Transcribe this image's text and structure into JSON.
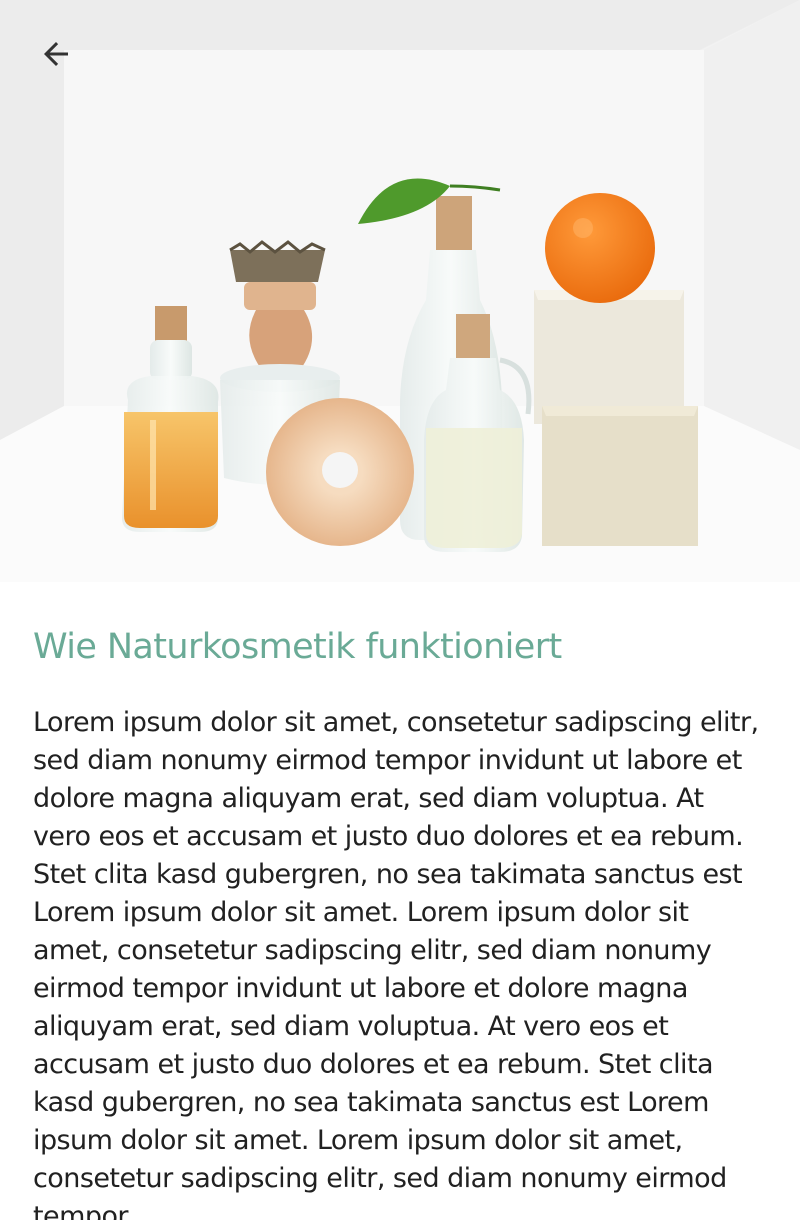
{
  "header": {
    "back_icon": "arrow-left-icon",
    "hero_image": "natural-cosmetics-bottles-soap-brush-orange-photo"
  },
  "article": {
    "title": "Wie Naturkosmetik funktioniert",
    "body": "Lorem ipsum dolor sit amet, consetetur sadipscing elitr, sed diam nonumy eirmod tempor invidunt ut labore et dolore magna aliquyam erat, sed diam voluptua. At vero eos et accusam et justo duo dolores et ea rebum. Stet clita kasd gubergren, no sea takimata sanctus est Lorem ipsum dolor sit amet. Lorem ipsum dolor sit amet, consetetur sadipscing elitr, sed diam nonumy eirmod tempor invidunt ut labore et dolore magna aliquyam erat, sed diam voluptua. At vero eos et accusam et justo duo dolores et ea rebum. Stet clita kasd gubergren, no sea takimata sanctus est Lorem ipsum dolor sit amet. Lorem ipsum dolor sit amet, consetetur sadipscing elitr, sed diam nonumy eirmod tempor"
  },
  "colors": {
    "title": "#6aaa96",
    "text": "#212121",
    "icon": "#333333"
  }
}
